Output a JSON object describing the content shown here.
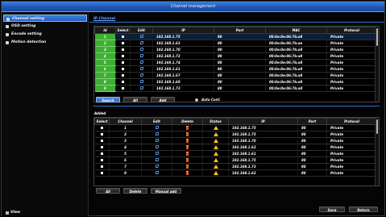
{
  "window": {
    "title": "Channel management"
  },
  "sidebar": {
    "items": [
      {
        "label": "Channel setting",
        "active": true
      },
      {
        "label": "OSD setting",
        "active": false
      },
      {
        "label": "Encode setting",
        "active": false
      },
      {
        "label": "Motion detection",
        "active": false
      }
    ],
    "view_label": "View"
  },
  "tab": {
    "label": "IP Channel"
  },
  "search_table": {
    "headers": [
      "Id",
      "Select",
      "Edit",
      "IP",
      "Port",
      "MAC",
      "Protocol"
    ],
    "rows": [
      {
        "id": "1",
        "ip": "192.168.1.75",
        "port": "80",
        "mac": "00:0e:0e:06:7b:a8",
        "protocol": "Private"
      },
      {
        "id": "2",
        "ip": "192.168.1.63",
        "port": "80",
        "mac": "00:0e:0e:06:7b:ae",
        "protocol": "Private"
      },
      {
        "id": "3",
        "ip": "192.168.1.70",
        "port": "80",
        "mac": "00:0e:0e:06:7b:a9",
        "protocol": "Private"
      },
      {
        "id": "4",
        "ip": "192.168.1.72",
        "port": "80",
        "mac": "00:0e:0e:06:7b:a8",
        "protocol": "Private"
      },
      {
        "id": "5",
        "ip": "192.168.1.74",
        "port": "80",
        "mac": "00:0e:0e:06:7b:a8",
        "protocol": "Private"
      },
      {
        "id": "6",
        "ip": "192.168.1.61",
        "port": "80",
        "mac": "00:0e:0e:06:7b:a9",
        "protocol": "Private"
      },
      {
        "id": "7",
        "ip": "192.168.1.67",
        "port": "80",
        "mac": "00:0e:0e:06:7b:a8",
        "protocol": "Private"
      },
      {
        "id": "8",
        "ip": "192.168.1.69",
        "port": "80",
        "mac": "00:0e:0e:06:7b:a8",
        "protocol": "Private"
      },
      {
        "id": "9",
        "ip": "192.168.1.73",
        "port": "80",
        "mac": "00:0e:0e:06:7b:a8",
        "protocol": "Private"
      }
    ]
  },
  "search_buttons": {
    "search": "Search",
    "all": "All",
    "add": "Add"
  },
  "auto_conf_label": "Auto Conf.",
  "added": {
    "label": "Added",
    "headers": [
      "Select",
      "Channel",
      "Edit",
      "Delete",
      "Status",
      "IP",
      "Port",
      "Protocol"
    ],
    "rows": [
      {
        "channel": "1",
        "ip": "192.168.1.75",
        "port": "80",
        "protocol": "Private"
      },
      {
        "channel": "2",
        "ip": "192.168.1.75",
        "port": "80",
        "protocol": "Private"
      },
      {
        "channel": "3",
        "ip": "192.168.1.70",
        "port": "80",
        "protocol": "Private"
      },
      {
        "channel": "4",
        "ip": "192.168.1.62",
        "port": "80",
        "protocol": "Private"
      },
      {
        "channel": "5",
        "ip": "192.168.1.61",
        "port": "80",
        "protocol": "Private"
      },
      {
        "channel": "6",
        "ip": "192.168.1.75",
        "port": "80",
        "protocol": "Private"
      },
      {
        "channel": "7",
        "ip": "192.168.1.73",
        "port": "80",
        "protocol": "Private"
      },
      {
        "channel": "8",
        "ip": "192.168.1.62",
        "port": "80",
        "protocol": "Private"
      }
    ]
  },
  "added_buttons": {
    "all": "All",
    "delete": "Delete",
    "manual_add": "Manual add"
  },
  "footer_buttons": {
    "save": "Save",
    "return": "Return"
  },
  "colors": {
    "accent": "#2d6fd1",
    "selected_id": "#3fae35",
    "warning": "#ffc21a",
    "delete": "#e25a23"
  }
}
